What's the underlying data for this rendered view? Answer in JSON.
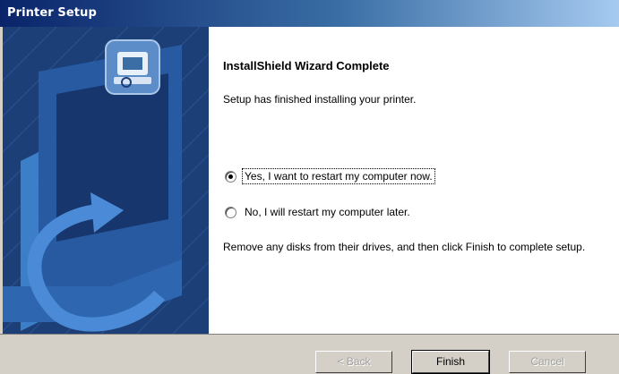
{
  "window": {
    "title": "Printer Setup"
  },
  "content": {
    "heading": "InstallShield Wizard Complete",
    "subtext": "Setup has finished installing your printer.",
    "radio_options": [
      {
        "label": "Yes, I want to restart my computer now.",
        "selected": true
      },
      {
        "label": "No, I will restart my computer later.",
        "selected": false
      }
    ],
    "note": "Remove any disks from their drives, and then click Finish to complete setup."
  },
  "buttons": {
    "back_label": "< Back",
    "finish_label": "Finish",
    "cancel_label": "Cancel"
  },
  "icons": {
    "wizard_graphic": "computer-arrow-graphic",
    "setup_icon": "printer-setup-icon"
  }
}
